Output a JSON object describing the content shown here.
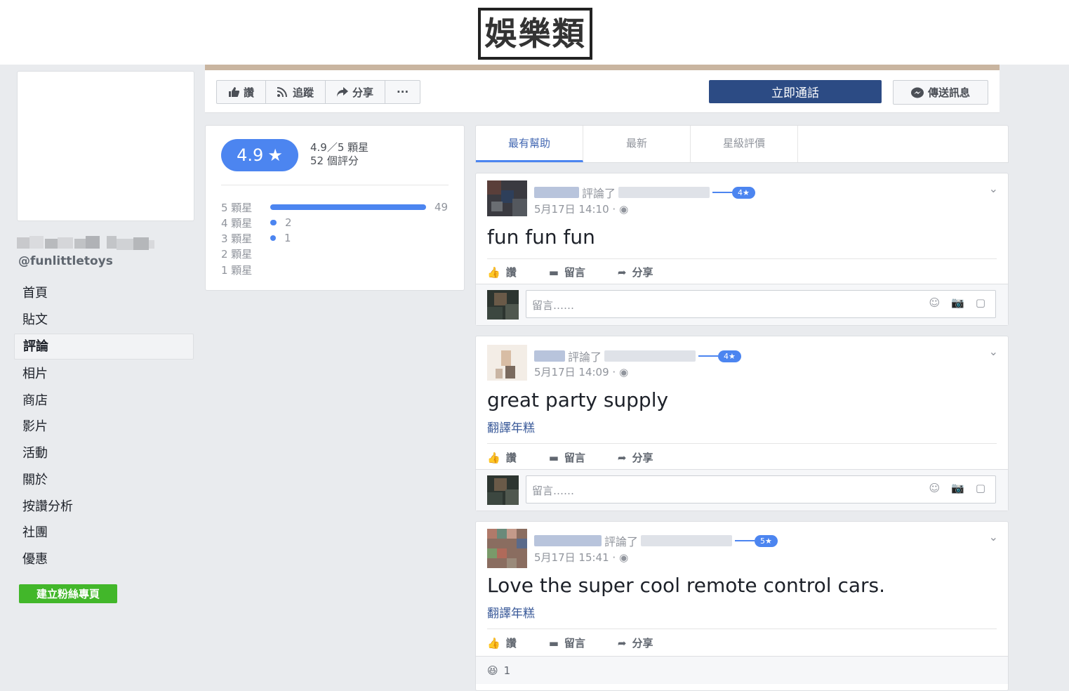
{
  "category_title": "娛樂類",
  "action_bar": {
    "like": "讚",
    "follow": "追蹤",
    "share": "分享",
    "more": "···",
    "call": "立即通話",
    "message": "傳送訊息"
  },
  "sidebar": {
    "username": "@funlittletoys",
    "items": [
      "首頁",
      "貼文",
      "評論",
      "相片",
      "商店",
      "影片",
      "活動",
      "關於",
      "按讚分析",
      "社團",
      "優惠"
    ],
    "active_index": 2,
    "create_page": "建立粉絲專頁"
  },
  "rating": {
    "score": "4.9",
    "summary_line1": "4.9／5 顆星",
    "summary_line2": "52 個評分",
    "rows": [
      {
        "label": "5 顆星",
        "count": "49",
        "fraction": 0.94
      },
      {
        "label": "4 顆星",
        "count": "2",
        "fraction": 0.04
      },
      {
        "label": "3 顆星",
        "count": "1",
        "fraction": 0.02
      },
      {
        "label": "2 顆星",
        "count": "",
        "fraction": 0
      },
      {
        "label": "1 顆星",
        "count": "",
        "fraction": 0
      }
    ]
  },
  "tabs": [
    "最有幫助",
    "最新",
    "星級評價"
  ],
  "posts": [
    {
      "reviewed": "評論了",
      "stars": "4★",
      "time": "5月17日 14:10 ·",
      "text": "fun fun fun",
      "translate": "",
      "like": "讚",
      "comment": "留言",
      "share": "分享",
      "comment_placeholder": "留言……"
    },
    {
      "reviewed": "評論了",
      "stars": "4★",
      "time": "5月17日 14:09 ·",
      "text": "great party supply",
      "translate": "翻譯年糕",
      "like": "讚",
      "comment": "留言",
      "share": "分享",
      "comment_placeholder": "留言……"
    },
    {
      "reviewed": "評論了",
      "stars": "5★",
      "time": "5月17日 15:41 ·",
      "text": "Love the super cool remote control cars.",
      "translate": "翻譯年糕",
      "like": "讚",
      "comment": "留言",
      "share": "分享",
      "reaction_count": "1"
    }
  ]
}
